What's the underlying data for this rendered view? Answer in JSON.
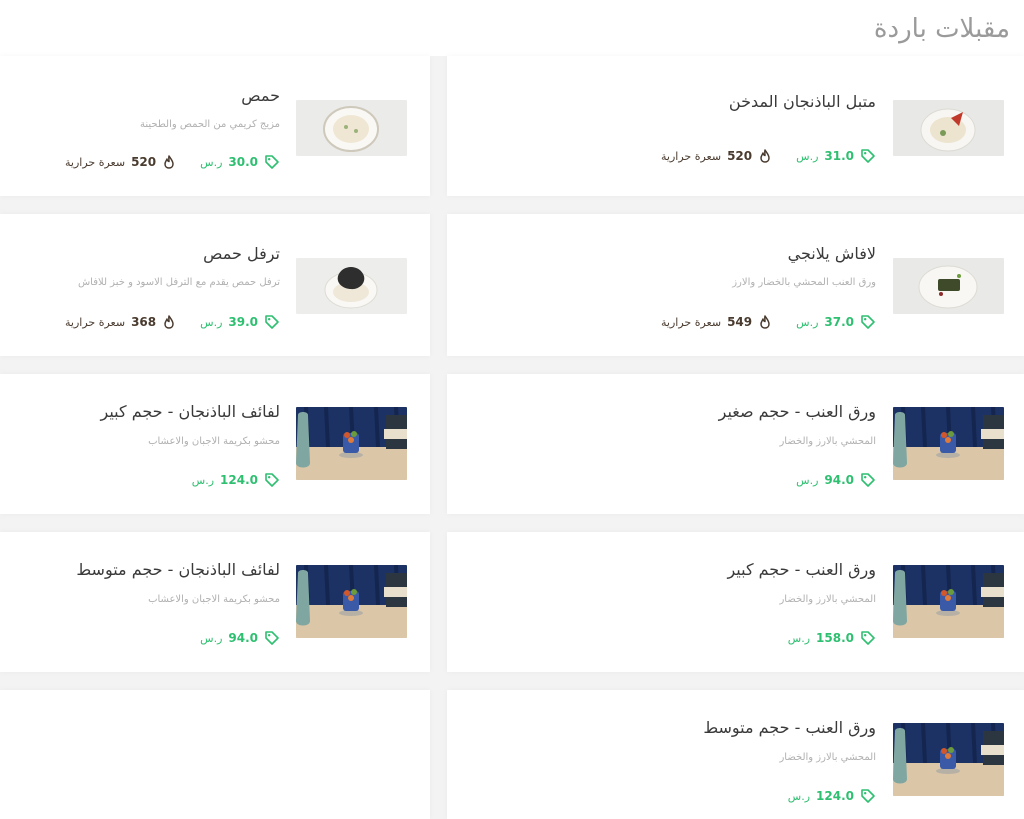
{
  "section": {
    "title": "مقبلات باردة"
  },
  "colors": {
    "accent": "#2fbf71",
    "calories": "#4a3b2f",
    "muted": "#b0b0b0"
  },
  "items": [
    {
      "name": "متبل الباذنجان المدخن",
      "desc": "",
      "price": "31.0",
      "currency": "ر.س",
      "calories": "520",
      "cal_label": "سعرة حرارية",
      "image": "plate-eggplant"
    },
    {
      "name": "حمص",
      "desc": "مزيج كريمي من الحمص والطحينة",
      "price": "30.0",
      "currency": "ر.س",
      "calories": "520",
      "cal_label": "سعرة حرارية",
      "image": "plate-hummus"
    },
    {
      "name": "لافاش يلانجي",
      "desc": "ورق العنب المحشي بالخضار والارز",
      "price": "37.0",
      "currency": "ر.س",
      "calories": "549",
      "cal_label": "سعرة حرارية",
      "image": "plate-yalanji"
    },
    {
      "name": "ترفل حمص",
      "desc": "ترفل حمص يقدم مع الترفل الاسود و خبز للافاش",
      "price": "39.0",
      "currency": "ر.س",
      "calories": "368",
      "cal_label": "سعرة حرارية",
      "image": "plate-truffle"
    },
    {
      "name": "ورق العنب - حجم صغير",
      "desc": "المحشي بالارز والخضار",
      "price": "94.0",
      "currency": "ر.س",
      "image": "scene-grapeleaves"
    },
    {
      "name": "لفائف الباذنجان - حجم كبير",
      "desc": "محشو بكريمة الاجبان والاعشاب",
      "price": "124.0",
      "currency": "ر.س",
      "image": "scene-eggplant-rolls"
    },
    {
      "name": "ورق العنب - حجم كبير",
      "desc": "المحشي بالارز والخضار",
      "price": "158.0",
      "currency": "ر.س",
      "image": "scene-grapeleaves"
    },
    {
      "name": "لفائف الباذنجان - حجم متوسط",
      "desc": "محشو بكريمة الاجبان والاعشاب",
      "price": "94.0",
      "currency": "ر.س",
      "image": "scene-eggplant-rolls"
    },
    {
      "name": "ورق العنب - حجم متوسط",
      "desc": "المحشي بالارز والخضار",
      "price": "124.0",
      "currency": "ر.س",
      "image": "scene-grapeleaves"
    }
  ]
}
